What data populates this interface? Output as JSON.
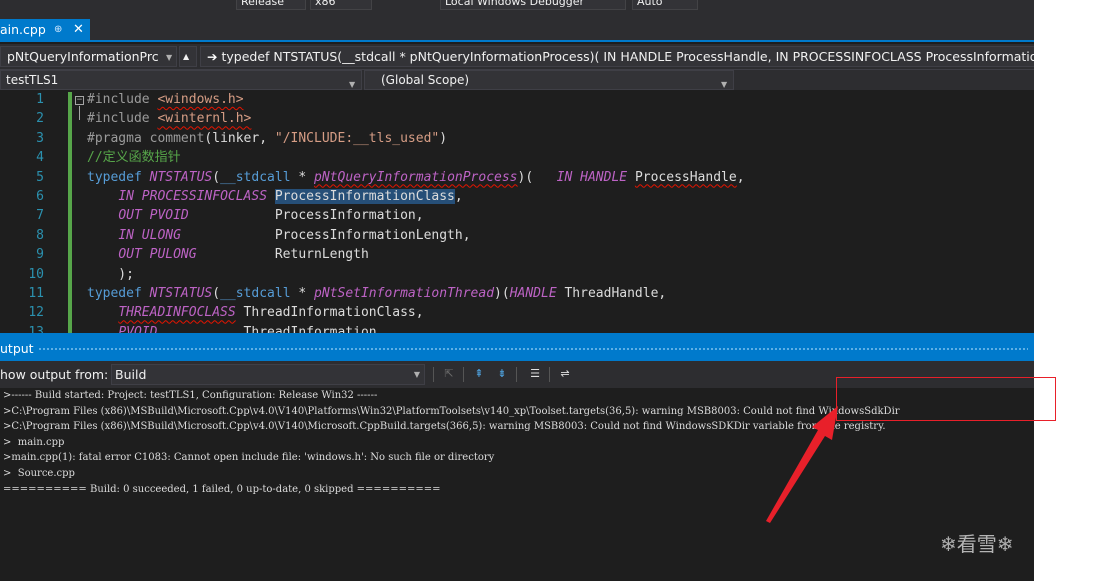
{
  "topbar": {
    "config": "Release",
    "platform": "x86",
    "debugger": "Local Windows Debugger",
    "mode": "Auto"
  },
  "tab": {
    "label": "ain.cpp",
    "pin": "⊕",
    "close": "✕"
  },
  "navbar": {
    "function_dropdown": "pNtQueryInformationPrc",
    "definition": "typedef NTSTATUS(__stdcall * pNtQueryInformationProcess)( IN HANDLE ProcessHandle, IN PROCESSINFOCLASS ProcessInformationClass,"
  },
  "scopebar": {
    "project": "testTLS1",
    "scope": "(Global Scope)"
  },
  "editor": {
    "line_numbers": [
      "1",
      "2",
      "3",
      "4",
      "5",
      "6",
      "7",
      "8",
      "9",
      "10",
      "11",
      "12",
      "13"
    ],
    "lines": [
      [
        {
          "t": "#include ",
          "c": "pp"
        },
        {
          "t": "<windows.h>",
          "c": "str sq"
        }
      ],
      [
        {
          "t": "#include ",
          "c": "pp"
        },
        {
          "t": "<winternl.h>",
          "c": "str sq"
        }
      ],
      [
        {
          "t": "#pragma ",
          "c": "pp"
        },
        {
          "t": "comment",
          "c": "pp"
        },
        {
          "t": "(linker, ",
          "c": "id"
        },
        {
          "t": "\"/INCLUDE:__tls_used\"",
          "c": "str"
        },
        {
          "t": ")",
          "c": "id"
        }
      ],
      [
        {
          "t": "//定义函数指针",
          "c": "cmt"
        }
      ],
      [
        {
          "t": "typedef ",
          "c": "kw"
        },
        {
          "t": "NTSTATUS",
          "c": "mac"
        },
        {
          "t": "(",
          "c": "id"
        },
        {
          "t": "__stdcall",
          "c": "kw"
        },
        {
          "t": " * ",
          "c": "id"
        },
        {
          "t": "pNtQueryInformationProcess",
          "c": "mac sq"
        },
        {
          "t": ")(   ",
          "c": "id"
        },
        {
          "t": "IN",
          "c": "mac"
        },
        {
          "t": " ",
          "c": "id"
        },
        {
          "t": "HANDLE",
          "c": "mac"
        },
        {
          "t": " ",
          "c": "id"
        },
        {
          "t": "ProcessHandle",
          "c": "id sq"
        },
        {
          "t": ",",
          "c": "id"
        }
      ],
      [
        {
          "t": "    ",
          "c": "id"
        },
        {
          "t": "IN",
          "c": "mac"
        },
        {
          "t": " ",
          "c": "id"
        },
        {
          "t": "PROCESSINFOCLASS",
          "c": "mac"
        },
        {
          "t": " ",
          "c": "id"
        },
        {
          "t": "ProcessInformationClass",
          "c": "id hl"
        },
        {
          "t": ",",
          "c": "id"
        }
      ],
      [
        {
          "t": "    ",
          "c": "id"
        },
        {
          "t": "OUT",
          "c": "mac"
        },
        {
          "t": " ",
          "c": "id"
        },
        {
          "t": "PVOID",
          "c": "mac"
        },
        {
          "t": "           ProcessInformation,",
          "c": "id"
        }
      ],
      [
        {
          "t": "    ",
          "c": "id"
        },
        {
          "t": "IN",
          "c": "mac"
        },
        {
          "t": " ",
          "c": "id"
        },
        {
          "t": "ULONG",
          "c": "mac"
        },
        {
          "t": "            ProcessInformationLength,",
          "c": "id"
        }
      ],
      [
        {
          "t": "    ",
          "c": "id"
        },
        {
          "t": "OUT",
          "c": "mac"
        },
        {
          "t": " ",
          "c": "id"
        },
        {
          "t": "PULONG",
          "c": "mac"
        },
        {
          "t": "          ReturnLength",
          "c": "id"
        }
      ],
      [
        {
          "t": "    );",
          "c": "id"
        }
      ],
      [
        {
          "t": "typedef ",
          "c": "kw"
        },
        {
          "t": "NTSTATUS",
          "c": "mac"
        },
        {
          "t": "(",
          "c": "id"
        },
        {
          "t": "__stdcall",
          "c": "kw"
        },
        {
          "t": " * ",
          "c": "id"
        },
        {
          "t": "pNtSetInformationThread",
          "c": "mac"
        },
        {
          "t": ")(",
          "c": "id"
        },
        {
          "t": "HANDLE",
          "c": "mac"
        },
        {
          "t": " ThreadHandle,",
          "c": "id"
        }
      ],
      [
        {
          "t": "    ",
          "c": "id"
        },
        {
          "t": "THREADINFOCLASS",
          "c": "mac sq"
        },
        {
          "t": " ThreadInformationClass,",
          "c": "id"
        }
      ],
      [
        {
          "t": "    ",
          "c": "id"
        },
        {
          "t": "PVOID",
          "c": "mac"
        },
        {
          "t": "           ThreadInformation,",
          "c": "id"
        }
      ]
    ]
  },
  "output": {
    "title": "utput",
    "show_output_label": "how output from:",
    "source": "Build",
    "lines": [
      ">------ Build started: Project: testTLS1, Configuration: Release Win32 ------",
      ">C:\\Program Files (x86)\\MSBuild\\Microsoft.Cpp\\v4.0\\V140\\Platforms\\Win32\\PlatformToolsets\\v140_xp\\Toolset.targets(36,5): warning MSB8003: Could not find WindowsSdkDir",
      ">C:\\Program Files (x86)\\MSBuild\\Microsoft.Cpp\\v4.0\\V140\\Microsoft.CppBuild.targets(366,5): warning MSB8003: Could not find WindowsSDKDir variable from the registry.",
      ">  main.cpp",
      ">main.cpp(1): fatal error C1083: Cannot open include file: 'windows.h': No such file or directory",
      ">  Source.cpp",
      "========== Build: 0 succeeded, 1 failed, 0 up-to-date, 0 skipped =========="
    ]
  },
  "watermark": {
    "text": "看雪"
  },
  "colors": {
    "accent": "#007acc",
    "annotation_red": "#e8202a",
    "editor_bg": "#1e1e1e",
    "change_bar": "#57a64a"
  }
}
